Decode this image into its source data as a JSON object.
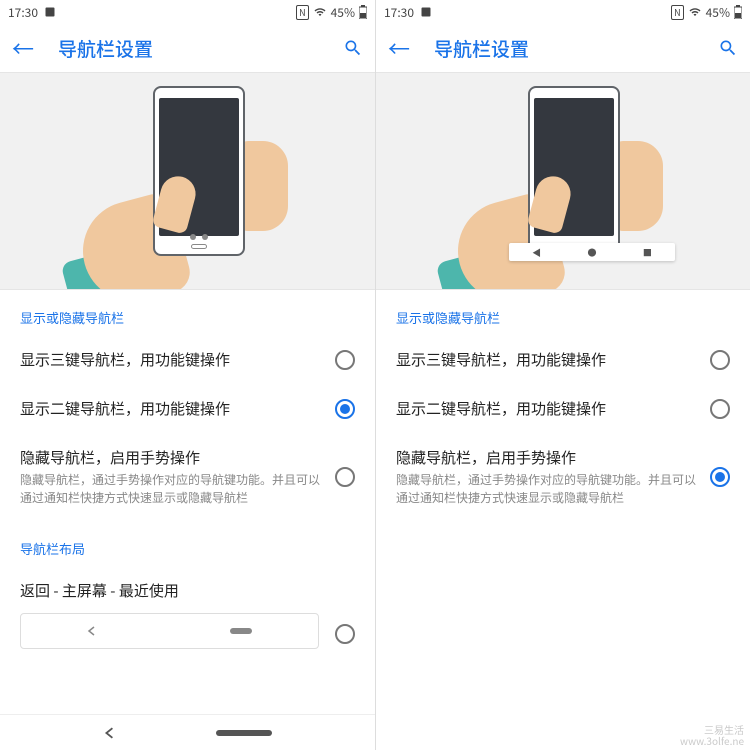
{
  "status_bar": {
    "time": "17:30",
    "nfc": "N",
    "battery_pct": "45%"
  },
  "app_bar": {
    "title": "导航栏设置"
  },
  "section_show_hide": "显示或隐藏导航栏",
  "options": {
    "three_key": "显示三键导航栏，用功能键操作",
    "two_key": "显示二键导航栏，用功能键操作",
    "gesture_title": "隐藏导航栏，启用手势操作",
    "gesture_desc": "隐藏导航栏，通过手势操作对应的导航键功能。并且可以通过通知栏快捷方式快速显示或隐藏导航栏"
  },
  "section_layout": "导航栏布局",
  "layout_option": "返回 - 主屏幕 - 最近使用",
  "left_selected": 1,
  "right_selected": 2,
  "watermark": {
    "l1": "三易生活",
    "l2": "www.3olfe.ne"
  }
}
